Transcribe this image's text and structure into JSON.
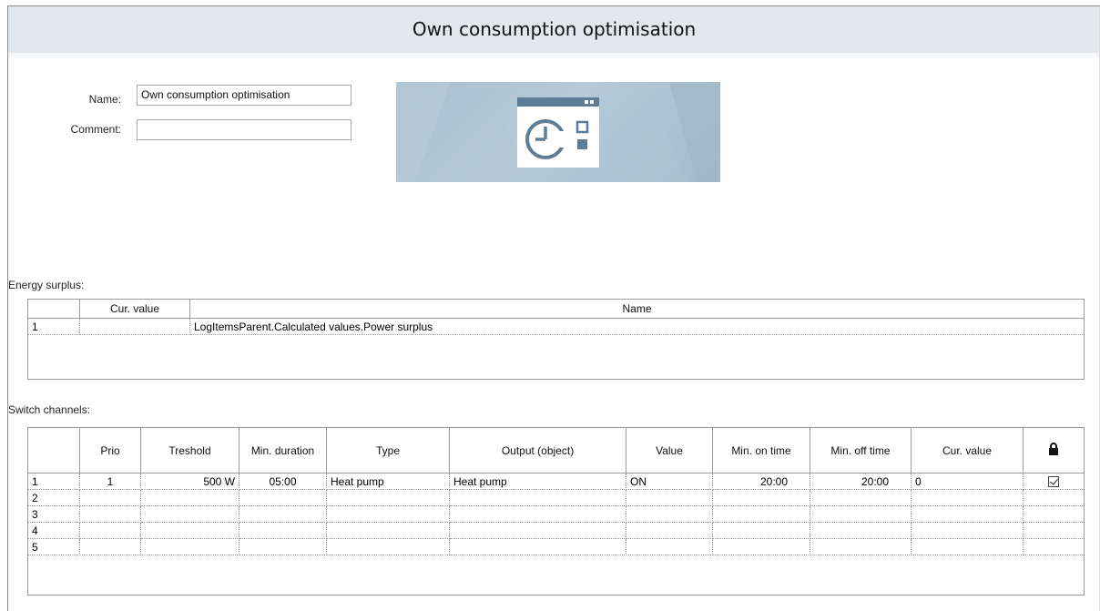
{
  "window": {
    "title": "Own consumption optimisation"
  },
  "form": {
    "name_label": "Name:",
    "name_value": "Own consumption optimisation",
    "comment_label": "Comment:",
    "comment_value": ""
  },
  "banner": {
    "icon": "clock-window-icon"
  },
  "energy_surplus": {
    "label": "Energy surplus:",
    "columns": [
      "",
      "Cur. value",
      "Name"
    ],
    "rows": [
      {
        "index": "1",
        "cur_value": "",
        "name": "LogItemsParent.Calculated values.Power surplus"
      }
    ]
  },
  "switch_channels": {
    "label": "Switch channels:",
    "columns": [
      "",
      "Prio",
      "Treshold",
      "Min. duration",
      "Type",
      "Output (object)",
      "Value",
      "Min. on time",
      "Min. off time",
      "Cur. value",
      "lock-icon"
    ],
    "rows": [
      {
        "index": "1",
        "prio": "1",
        "threshold": "500 W",
        "min_duration": "05:00",
        "type": "Heat pump",
        "output": "Heat pump",
        "value": "ON",
        "min_on": "20:00",
        "min_off": "20:00",
        "cur_value": "0",
        "locked": true
      },
      {
        "index": "2",
        "prio": "",
        "threshold": "",
        "min_duration": "",
        "type": "",
        "output": "",
        "value": "",
        "min_on": "",
        "min_off": "",
        "cur_value": "",
        "locked": false
      },
      {
        "index": "3",
        "prio": "",
        "threshold": "",
        "min_duration": "",
        "type": "",
        "output": "",
        "value": "",
        "min_on": "",
        "min_off": "",
        "cur_value": "",
        "locked": false
      },
      {
        "index": "4",
        "prio": "",
        "threshold": "",
        "min_duration": "",
        "type": "",
        "output": "",
        "value": "",
        "min_on": "",
        "min_off": "",
        "cur_value": "",
        "locked": false
      },
      {
        "index": "5",
        "prio": "",
        "threshold": "",
        "min_duration": "",
        "type": "",
        "output": "",
        "value": "",
        "min_on": "",
        "min_off": "",
        "cur_value": "",
        "locked": false
      }
    ]
  }
}
